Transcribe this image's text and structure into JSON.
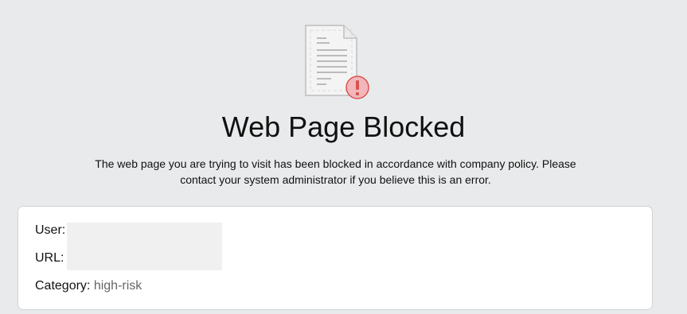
{
  "page": {
    "title": "Web Page Blocked",
    "message": "The web page you are trying to visit has been blocked in accordance with company policy. Please contact your system administrator if you believe this is an error."
  },
  "details": {
    "user_label": "User:",
    "user_value": "",
    "url_label": "URL:",
    "url_value": "",
    "category_label": "Category:",
    "category_value": "high-risk"
  },
  "icon": {
    "name": "blocked-document-icon",
    "alert_color": "#f2b6bb",
    "alert_stroke": "#d9534f"
  },
  "colors": {
    "background": "#e8eaeb",
    "card": "#ffffff",
    "text": "#111111",
    "muted_text": "#666666"
  }
}
